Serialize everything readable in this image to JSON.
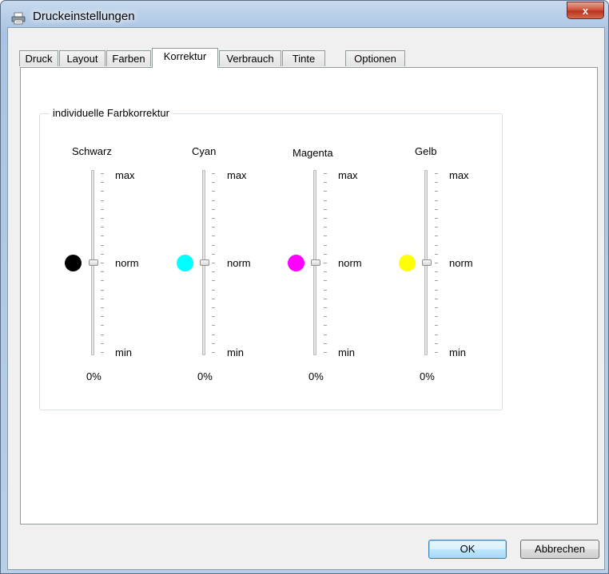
{
  "window": {
    "title": "Druckeinstellungen",
    "close_label": "x"
  },
  "tabs": [
    {
      "label": "Druck",
      "active": false
    },
    {
      "label": "Layout",
      "active": false
    },
    {
      "label": "Farben",
      "active": false
    },
    {
      "label": "Korrektur",
      "active": true
    },
    {
      "label": "Verbrauch",
      "active": false
    },
    {
      "label": "Tinte",
      "active": false
    },
    {
      "label": "Optionen",
      "active": false
    }
  ],
  "group": {
    "title": "individuelle Farbkorrektur"
  },
  "channels": [
    {
      "name": "Schwarz",
      "color": "#000000",
      "value_text": "0%",
      "level": 0.5
    },
    {
      "name": "Cyan",
      "color": "#00ffff",
      "value_text": "0%",
      "level": 0.5
    },
    {
      "name": "Magenta",
      "color": "#ff00ff",
      "value_text": "0%",
      "level": 0.5
    },
    {
      "name": "Gelb",
      "color": "#ffff00",
      "value_text": "0%",
      "level": 0.5
    }
  ],
  "scale_labels": {
    "max": "max",
    "norm": "norm",
    "min": "min"
  },
  "buttons": {
    "ok": "OK",
    "cancel": "Abbrechen"
  }
}
